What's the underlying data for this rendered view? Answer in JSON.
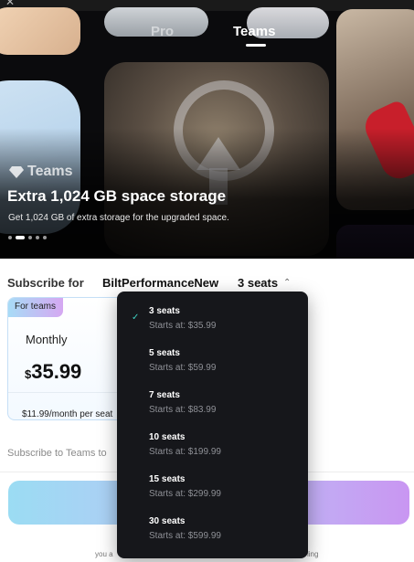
{
  "hero": {
    "tabs": [
      {
        "label": "Pro",
        "active": false
      },
      {
        "label": "Teams",
        "active": true
      }
    ],
    "badge": "Teams",
    "title": "Extra 1,024 GB space storage",
    "subtitle": "Get 1,024 GB of extra storage for the upgraded space.",
    "carousel": {
      "total": 5,
      "active_index": 1
    }
  },
  "subscribe": {
    "label": "Subscribe for",
    "organization": "BiltPerformanceNew",
    "seats": "3 seats"
  },
  "plan_card": {
    "tag": "For teams",
    "period": "Monthly",
    "currency": "$",
    "price": "35.99",
    "per_seat": "$11.99/month per seat"
  },
  "note": "Subscribe to Teams to",
  "legal": {
    "left": "you a",
    "right": "ling"
  },
  "dropdown": {
    "selected_index": 0,
    "options": [
      {
        "seats": "3 seats",
        "price": "Starts at: $35.99"
      },
      {
        "seats": "5 seats",
        "price": "Starts at: $59.99"
      },
      {
        "seats": "7 seats",
        "price": "Starts at: $83.99"
      },
      {
        "seats": "10 seats",
        "price": "Starts at: $199.99"
      },
      {
        "seats": "15 seats",
        "price": "Starts at: $299.99"
      },
      {
        "seats": "30 seats",
        "price": "Starts at: $599.99"
      }
    ]
  },
  "colors": {
    "cta_gradient_start": "#9bdcf3",
    "cta_gradient_end": "#c996f2",
    "check_accent": "#3fd0c0",
    "dropdown_bg": "#16171b"
  },
  "icons": [
    "gem-icon",
    "chevron-up-icon",
    "check-icon",
    "cloud-upload-icon"
  ]
}
